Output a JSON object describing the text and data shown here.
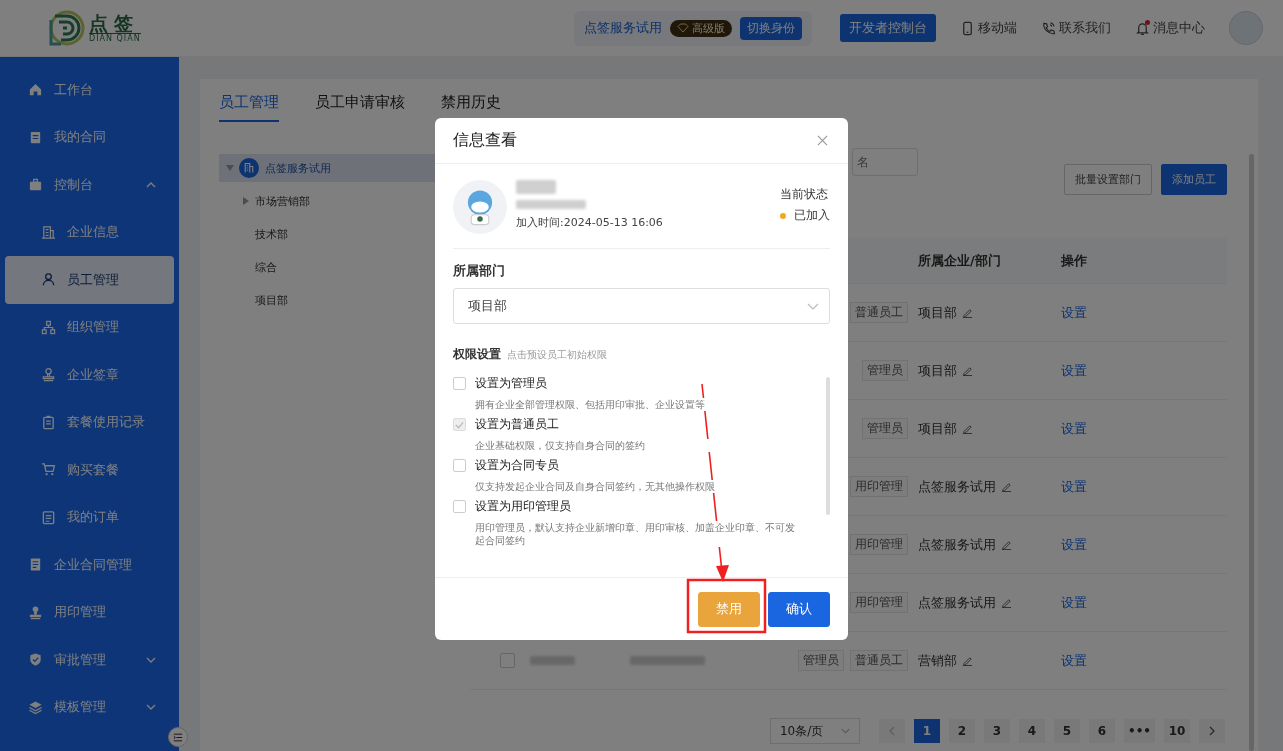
{
  "header": {
    "logo": {
      "title": "点签",
      "subtitle": "DIAN QIAN"
    },
    "org": {
      "name": "点签服务试用",
      "plan": "高级版",
      "switch_button": "切换身份"
    },
    "console_button": "开发者控制台",
    "links": [
      {
        "kind": "mobile",
        "label": "移动端",
        "unread": false
      },
      {
        "kind": "contact",
        "label": "联系我们",
        "unread": false
      },
      {
        "kind": "bell",
        "label": "消息中心",
        "unread": true
      }
    ]
  },
  "sidebar": {
    "items": [
      {
        "kind": "home",
        "label": "工作台",
        "selected": false
      },
      {
        "kind": "doc",
        "label": "我的合同",
        "selected": false
      },
      {
        "kind": "console",
        "label": "控制台",
        "selected": false,
        "expanded": true,
        "children": [
          {
            "kind": "building",
            "label": "企业信息",
            "selected": false
          },
          {
            "kind": "user",
            "label": "员工管理",
            "selected": true
          },
          {
            "kind": "org",
            "label": "组织管理",
            "selected": false
          },
          {
            "kind": "stamp",
            "label": "企业签章",
            "selected": false
          },
          {
            "kind": "record",
            "label": "套餐使用记录",
            "selected": false
          },
          {
            "kind": "cart",
            "label": "购买套餐",
            "selected": false
          },
          {
            "kind": "list",
            "label": "我的订单",
            "selected": false
          }
        ]
      },
      {
        "kind": "contract",
        "label": "企业合同管理",
        "selected": false
      },
      {
        "kind": "seal",
        "label": "用印管理",
        "selected": false
      },
      {
        "kind": "approve",
        "label": "审批管理",
        "selected": false,
        "expanded": false
      },
      {
        "kind": "layers",
        "label": "模板管理",
        "selected": false,
        "expanded": false
      }
    ]
  },
  "tabs": [
    {
      "label": "员工管理",
      "selected": true
    },
    {
      "label": "员工申请审核",
      "selected": false
    },
    {
      "label": "禁用历史",
      "selected": false
    }
  ],
  "tree": {
    "label": "点签服务试用",
    "expanded": true,
    "selected": true,
    "children": [
      {
        "label": "市场营销部",
        "collapsible": true,
        "selected": false
      },
      {
        "label": "技术部",
        "collapsible": false,
        "selected": false
      },
      {
        "label": "综合",
        "collapsible": false,
        "selected": false
      },
      {
        "label": "项目部",
        "collapsible": false,
        "selected": false
      }
    ]
  },
  "toolbar": {
    "search_placeholder": "名",
    "buttons": [
      {
        "label": "批量设置部门",
        "kind": "default"
      },
      {
        "label": "添加员工",
        "kind": "primary"
      }
    ]
  },
  "table": {
    "columns": [
      "所属企业/部门",
      "操作"
    ],
    "rows": [
      {
        "roles": [
          "普通员工"
        ],
        "department": "项目部",
        "action": "设置"
      },
      {
        "roles": [
          "管理员"
        ],
        "department": "项目部",
        "action": "设置"
      },
      {
        "roles": [
          "管理员"
        ],
        "department": "项目部",
        "action": "设置"
      },
      {
        "roles": [
          "用印管理"
        ],
        "department": "点签服务试用",
        "action": "设置"
      },
      {
        "roles": [
          "用印管理"
        ],
        "department": "点签服务试用",
        "action": "设置"
      },
      {
        "roles": [
          "用印管理"
        ],
        "department": "点签服务试用",
        "action": "设置"
      },
      {
        "checked": false,
        "roles": [
          "管理员",
          "普通员工"
        ],
        "department": "营销部",
        "action": "设置"
      }
    ]
  },
  "pagination": {
    "page_size": "10条/页",
    "pages": [
      {
        "label": "1",
        "selected": true
      },
      {
        "label": "2",
        "selected": false
      },
      {
        "label": "3",
        "selected": false
      },
      {
        "label": "4",
        "selected": false
      },
      {
        "label": "5",
        "selected": false
      },
      {
        "label": "6",
        "selected": false
      },
      {
        "label": "•••",
        "selected": false
      },
      {
        "label": "10",
        "selected": false
      }
    ]
  },
  "dialog": {
    "title": "信息查看",
    "member": {
      "join_time": "加入时间:2024-05-13 16:06",
      "status_label": "当前状态",
      "status": "已加入"
    },
    "department": {
      "label": "所属部门",
      "value": "项目部"
    },
    "permissions": {
      "label": "权限设置",
      "hint": "点击预设员工初始权限",
      "options": [
        {
          "title": "设置为管理员",
          "description": "拥有企业全部管理权限、包括用印审批、企业设置等",
          "checked": false,
          "disabled": false
        },
        {
          "title": "设置为普通员工",
          "description": "企业基础权限，仅支持自身合同的签约",
          "checked": true,
          "disabled": true
        },
        {
          "title": "设置为合同专员",
          "description": "仅支持发起企业合同及自身合同签约，无其他操作权限",
          "checked": false,
          "disabled": false
        },
        {
          "title": "设置为用印管理员",
          "description": "用印管理员，默认支持企业新增印章、用印审核、加盖企业印章、不可发起合同签约",
          "checked": false,
          "disabled": false
        }
      ]
    },
    "buttons": [
      {
        "label": "禁用",
        "kind": "warning"
      },
      {
        "label": "确认",
        "kind": "primary"
      }
    ]
  }
}
